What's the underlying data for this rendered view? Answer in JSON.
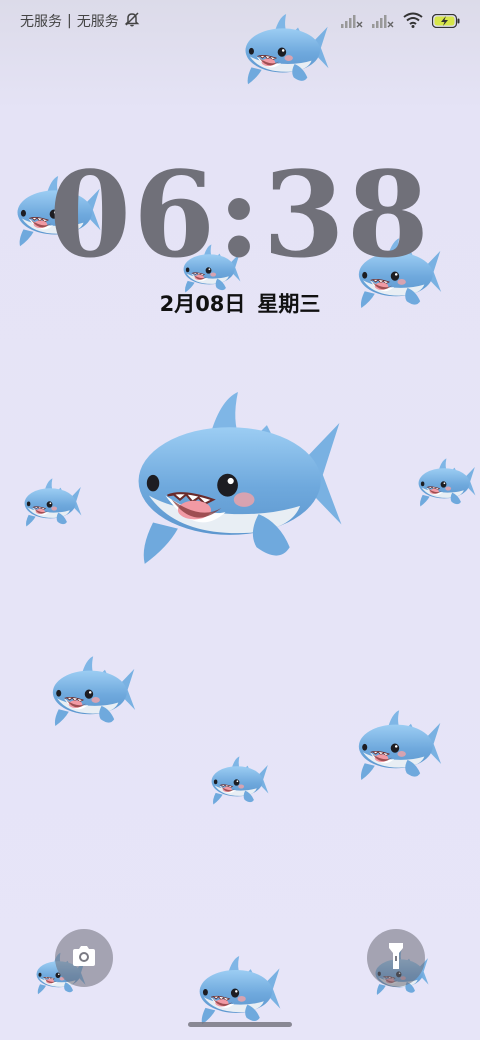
{
  "status_bar": {
    "carrier_1": "无服务",
    "separator": "|",
    "carrier_2": "无服务"
  },
  "lockscreen": {
    "time": "06:38",
    "date": "2月08日",
    "weekday": "星期三"
  },
  "shortcuts": {
    "left_icon": "camera-icon",
    "right_icon": "flashlight-icon"
  },
  "wallpaper": {
    "motif": "shark-icon",
    "colors": {
      "background": "#e7e5f8",
      "shark_body": "#7fb6e6",
      "clock": "#707079"
    }
  }
}
